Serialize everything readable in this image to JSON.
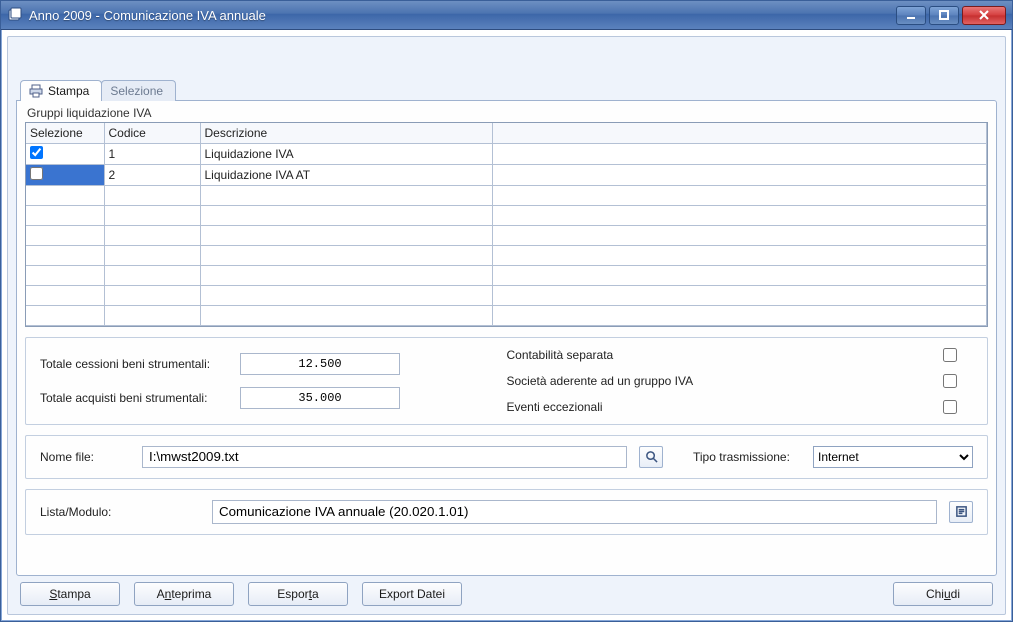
{
  "window": {
    "title": "Anno 2009 - Comunicazione IVA annuale"
  },
  "tabs": {
    "active": "Stampa",
    "inactive": "Selezione"
  },
  "grid": {
    "title": "Gruppi liquidazione IVA",
    "headers": {
      "sel": "Selezione",
      "cod": "Codice",
      "desc": "Descrizione"
    },
    "rows": [
      {
        "checked": true,
        "codice": "1",
        "descrizione": "Liquidazione IVA",
        "selected": false
      },
      {
        "checked": false,
        "codice": "2",
        "descrizione": "Liquidazione IVA AT",
        "selected": true
      }
    ]
  },
  "fields": {
    "tot_cessioni_label": "Totale cessioni beni strumentali:",
    "tot_cessioni_value": "12.500",
    "tot_acquisti_label": "Totale acquisti beni strumentali:",
    "tot_acquisti_value": "35.000",
    "contab_separata_label": "Contabilità separata",
    "societa_gruppo_label": "Società aderente ad un gruppo IVA",
    "eventi_ecc_label": "Eventi eccezionali"
  },
  "file": {
    "label": "Nome file:",
    "value": "I:\\mwst2009.txt",
    "tipo_label": "Tipo trasmissione:",
    "tipo_value": "Internet"
  },
  "modulo": {
    "label": "Lista/Modulo:",
    "value": "Comunicazione IVA annuale (20.020.1.01)"
  },
  "buttons": {
    "stampa": "Stampa",
    "anteprima": "Anteprima",
    "esporta": "Esporta",
    "export_datei": "Export Datei",
    "chiudi": "Chiudi"
  }
}
